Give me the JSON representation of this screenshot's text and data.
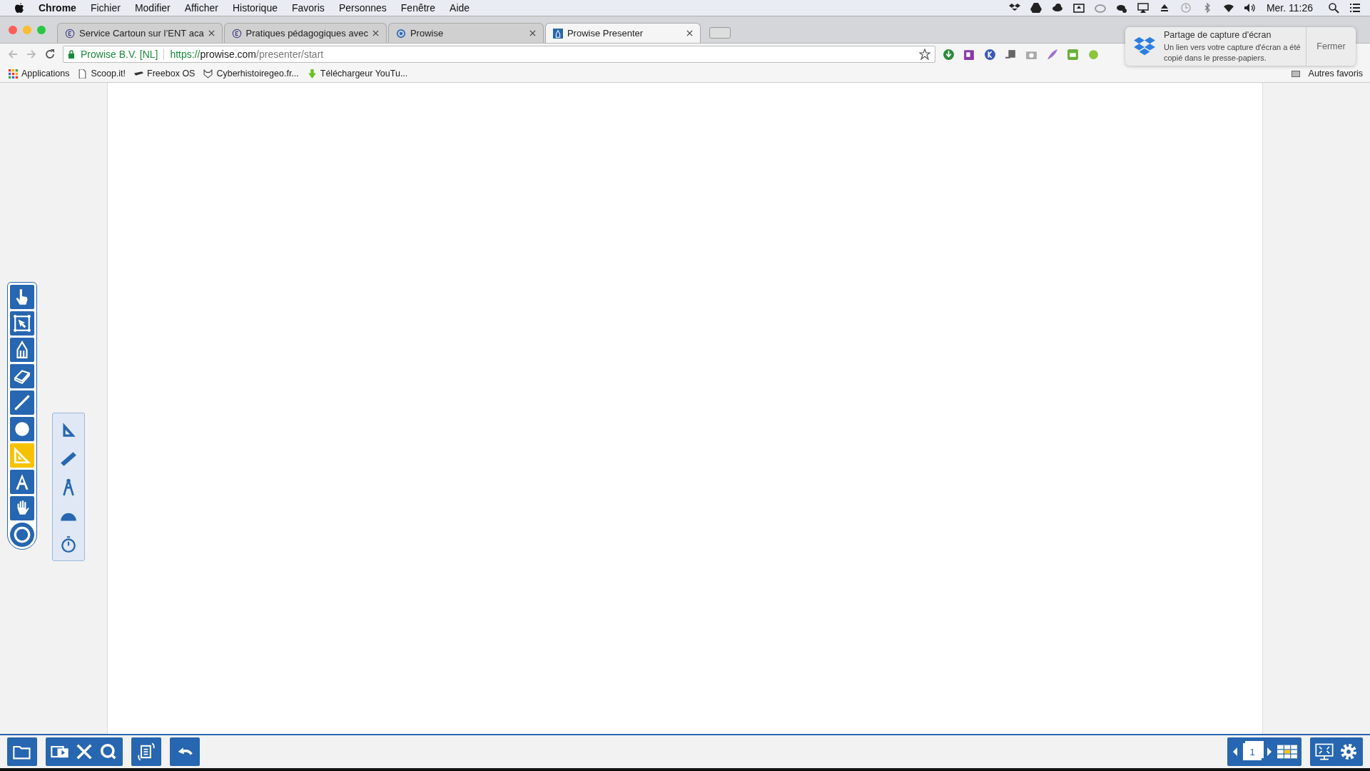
{
  "menubar": {
    "app": "Chrome",
    "items": [
      "Fichier",
      "Modifier",
      "Afficher",
      "Historique",
      "Favoris",
      "Personnes",
      "Fenêtre",
      "Aide"
    ],
    "clock": "Mer. 11:26"
  },
  "tabs": [
    {
      "title": "Service Cartoun sur l’ENT aca",
      "kind": "edu",
      "selected": false
    },
    {
      "title": "Pratiques pédagogiques avec",
      "kind": "edu",
      "selected": false
    },
    {
      "title": "Prowise",
      "kind": "ring",
      "selected": false
    },
    {
      "title": "Prowise Presenter",
      "kind": "prowise",
      "selected": true
    }
  ],
  "address": {
    "security": "Prowise B.V. [NL]",
    "scheme": "https://",
    "host": "prowise.com",
    "path": "/presenter/start"
  },
  "bookmarks": [
    {
      "label": "Applications",
      "kind": "apps"
    },
    {
      "label": "Scoop.it!",
      "kind": "page"
    },
    {
      "label": "Freebox OS",
      "kind": "box"
    },
    {
      "label": "Cyberhistoiregeo.fr...",
      "kind": "cat"
    },
    {
      "label": "Téléchargeur YouTu...",
      "kind": "download"
    }
  ],
  "other_bookmarks": "Autres favoris",
  "notification": {
    "title": "Partage de capture d'écran",
    "message": "Un lien vers votre capture d'écran a été copié dans le presse-papiers.",
    "action": "Fermer"
  },
  "tools": [
    {
      "kind": "pointer",
      "selected": false
    },
    {
      "kind": "select",
      "selected": false
    },
    {
      "kind": "pen",
      "selected": false
    },
    {
      "kind": "eraser",
      "selected": false
    },
    {
      "kind": "line",
      "selected": false
    },
    {
      "kind": "shape",
      "selected": false
    },
    {
      "kind": "geometry",
      "selected": true
    },
    {
      "kind": "text",
      "selected": false
    },
    {
      "kind": "pan",
      "selected": false
    },
    {
      "kind": "menu",
      "selected": false
    }
  ],
  "geometry_tools": [
    {
      "kind": "set-square"
    },
    {
      "kind": "ruler"
    },
    {
      "kind": "compass"
    },
    {
      "kind": "protractor"
    },
    {
      "kind": "stopwatch"
    }
  ],
  "page_number": "1"
}
